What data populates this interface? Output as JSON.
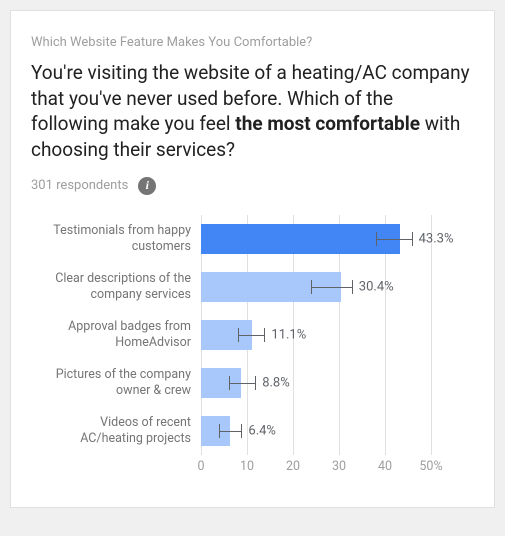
{
  "overline": "Which Website Feature Makes You Comfortable?",
  "title_parts": {
    "a": "You're visiting the website of a heating/AC company that you've never used before. Which of the following make you feel ",
    "b": "the most comfortable",
    "c": " with choosing their services?"
  },
  "respondents_label": "301 respondents",
  "chart_data": {
    "type": "bar",
    "orientation": "horizontal",
    "xlim": [
      0,
      50
    ],
    "x_ticks": [
      0,
      10,
      20,
      30,
      40,
      "50%"
    ],
    "series": [
      {
        "label": "Testimonials from happy customers",
        "value": 43.3,
        "err_low": 38,
        "err_high": 46,
        "display": "43.3%",
        "highlight": true
      },
      {
        "label": "Clear descriptions of the company services",
        "value": 30.4,
        "err_low": 24,
        "err_high": 33,
        "display": "30.4%",
        "highlight": false
      },
      {
        "label": "Approval badges from HomeAdvisor",
        "value": 11.1,
        "err_low": 8,
        "err_high": 14,
        "display": "11.1%",
        "highlight": false
      },
      {
        "label": "Pictures of the company owner & crew",
        "value": 8.8,
        "err_low": 6,
        "err_high": 12,
        "display": "8.8%",
        "highlight": false
      },
      {
        "label": "Videos of recent AC/heating projects",
        "value": 6.4,
        "err_low": 4,
        "err_high": 9,
        "display": "6.4%",
        "highlight": false
      }
    ]
  }
}
